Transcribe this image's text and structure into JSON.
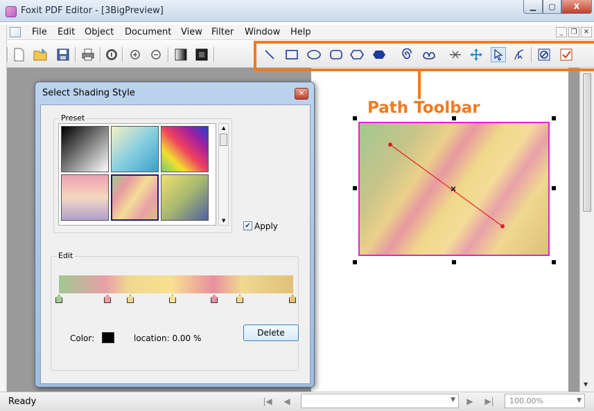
{
  "window": {
    "title": "Foxit PDF Editor - [3BigPreview]",
    "close_label": "X"
  },
  "menu": {
    "items": [
      "File",
      "Edit",
      "Object",
      "Document",
      "View",
      "Filter",
      "Window",
      "Help"
    ]
  },
  "toolbar": {
    "buttons": [
      "new-icon",
      "open-icon",
      "save-icon",
      "print-icon",
      "info-icon",
      "zoom-in-icon",
      "zoom-out-icon",
      "shading-icon",
      "black-fill-icon"
    ],
    "path_buttons": [
      "line-icon",
      "rectangle-icon",
      "ellipse-icon",
      "rounded-rect-icon",
      "polygon-icon",
      "diamond-icon",
      "spiral-icon",
      "curve-icon",
      "scissors-icon",
      "move-icon",
      "arrow-select-icon",
      "node-select-icon",
      "clip-icon",
      "check-icon"
    ]
  },
  "annotation": {
    "label": "Path Toolbar",
    "color": "#f07a20"
  },
  "dialog": {
    "title": "Select Shading Style",
    "preset_label": "Preset",
    "apply_label": "Apply",
    "apply_checked": true,
    "edit_label": "Edit",
    "color_label": "Color:",
    "location_text": "location: 0.00  %",
    "delete_label": "Delete"
  },
  "status": {
    "text": "Ready",
    "zoom": "100.00%"
  },
  "colors": {
    "selection": "#e820d0",
    "accent": "#f07a20"
  }
}
